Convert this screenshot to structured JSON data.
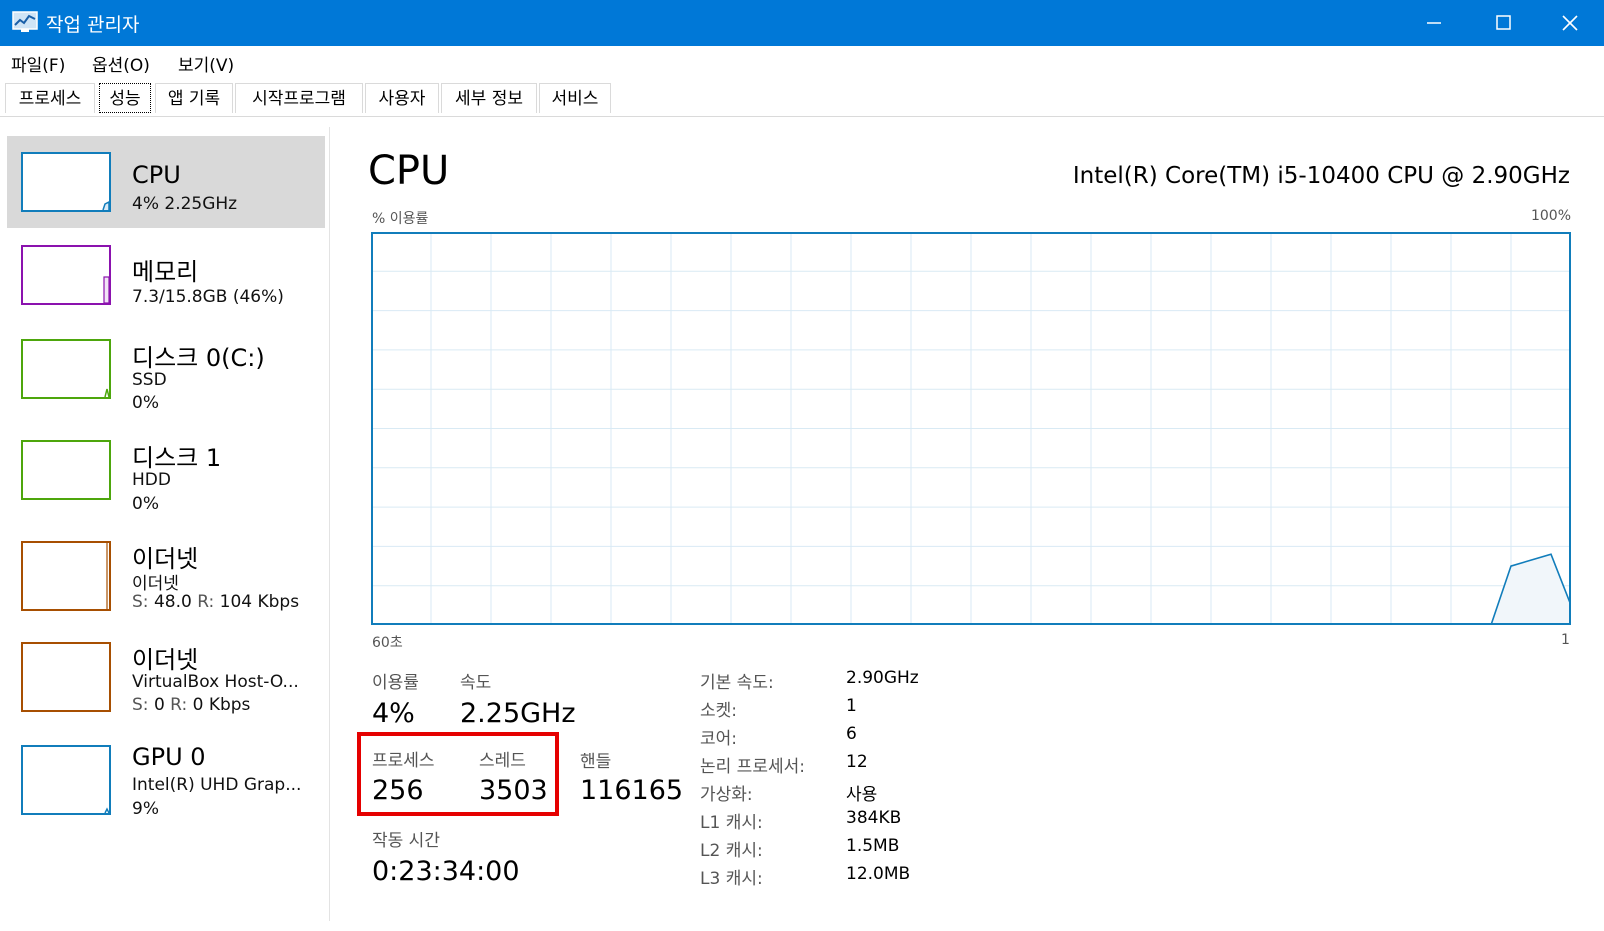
{
  "window": {
    "title": "작업 관리자"
  },
  "menu": [
    "파일(F)",
    "옵션(O)",
    "보기(V)"
  ],
  "tabs": [
    "프로세스",
    "성능",
    "앱 기록",
    "시작프로그램",
    "사용자",
    "세부 정보",
    "서비스"
  ],
  "active_tab": "성능",
  "sidebar": [
    {
      "title": "CPU",
      "sub1": "4% 2.25GHz",
      "color": "#117dbb"
    },
    {
      "title": "메모리",
      "sub1": "7.3/15.8GB (46%)",
      "color": "#8b12ae"
    },
    {
      "title": "디스크 0(C:)",
      "sub1": "SSD",
      "sub2": "0%",
      "color": "#4da60c"
    },
    {
      "title": "디스크 1",
      "sub1": "HDD",
      "sub2": "0%",
      "color": "#4da60c"
    },
    {
      "title": "이더넷",
      "sub1": "이더넷",
      "sub2_s": "S:",
      "sub2_sv": "48.0",
      "sub2_r": "R:",
      "sub2_rv": "104 Kbps",
      "color": "#a74f01"
    },
    {
      "title": "이더넷",
      "sub1": "VirtualBox Host-O...",
      "sub2_s": "S:",
      "sub2_sv": "0",
      "sub2_r": "R:",
      "sub2_rv": "0 Kbps",
      "color": "#a74f01"
    },
    {
      "title": "GPU 0",
      "sub1": "Intel(R) UHD Grap...",
      "sub2": "9%",
      "color": "#117dbb"
    }
  ],
  "main": {
    "title": "CPU",
    "model": "Intel(R) Core(TM) i5-10400 CPU @ 2.90GHz",
    "y_axis_label": "% 이용률",
    "y_max_label": "100%",
    "x_left_label": "60초",
    "x_right_label": "1",
    "graph_color": "#117dbb"
  },
  "chart_data": {
    "type": "area",
    "x_range": [
      60,
      0
    ],
    "y_range": [
      0,
      100
    ],
    "grid": true,
    "series": [
      {
        "x": [
          60,
          4,
          3,
          1,
          0
        ],
        "y": [
          0,
          0,
          15,
          18,
          5
        ]
      }
    ]
  },
  "stats": {
    "utilization_label": "이용률",
    "utilization_value": "4%",
    "speed_label": "속도",
    "speed_value": "2.25GHz",
    "process_label": "프로세스",
    "process_value": "256",
    "thread_label": "스레드",
    "thread_value": "3503",
    "handle_label": "핸들",
    "handle_value": "116165",
    "uptime_label": "작동 시간",
    "uptime_value": "0:23:34:00"
  },
  "info": [
    {
      "label": "기본 속도:",
      "value": "2.90GHz"
    },
    {
      "label": "소켓:",
      "value": "1"
    },
    {
      "label": "코어:",
      "value": "6"
    },
    {
      "label": "논리 프로세서:",
      "value": "12"
    },
    {
      "label": "가상화:",
      "value": "사용"
    },
    {
      "label": "L1 캐시:",
      "value": "384KB"
    },
    {
      "label": "L2 캐시:",
      "value": "1.5MB"
    },
    {
      "label": "L3 캐시:",
      "value": "12.0MB"
    }
  ]
}
